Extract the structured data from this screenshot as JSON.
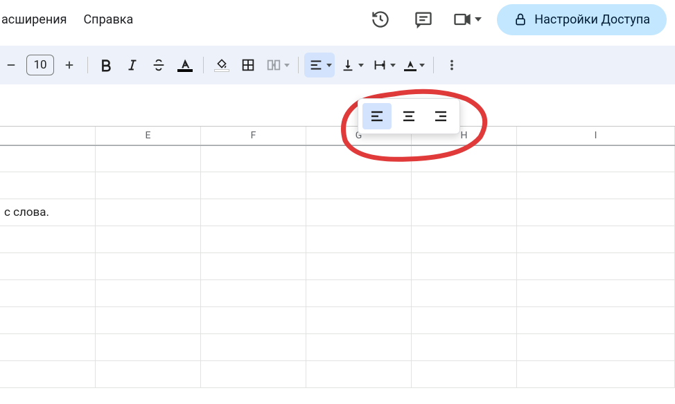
{
  "menu": {
    "extensions": "асширения",
    "help": "Справка"
  },
  "share": {
    "label": "Настройки Доступа"
  },
  "toolbar": {
    "font_size": "10"
  },
  "columns": [
    "E",
    "F",
    "G",
    "H",
    "I"
  ],
  "cells": {
    "row2_partial": "с слова."
  },
  "col_widths": {
    "partial": 138,
    "default": 152,
    "last": 228
  },
  "row_count": 9
}
